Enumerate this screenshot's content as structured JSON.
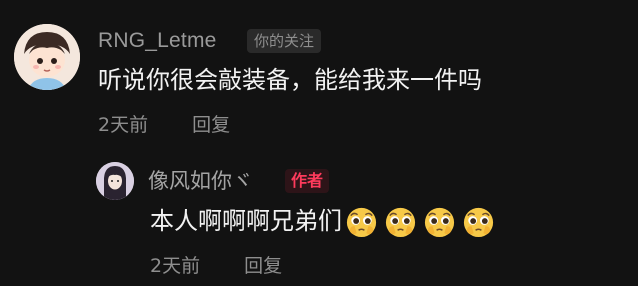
{
  "comment": {
    "username": "RNG_Letme",
    "badge": "你的关注",
    "text": "听说你很会敲装备，能给我来一件吗",
    "time": "2天前",
    "reply_label": "回复"
  },
  "reply": {
    "username": "像风如你ヾ",
    "author_badge": "作者",
    "text": "本人啊啊啊兄弟们",
    "emoji_name": "pleading-face-icon",
    "emoji_count": 4,
    "time": "2天前",
    "reply_label": "回复"
  },
  "colors": {
    "background": "#121212",
    "text": "#f2f2f2",
    "meta": "#8e8e8e",
    "author_badge": "#ff3b5c"
  }
}
